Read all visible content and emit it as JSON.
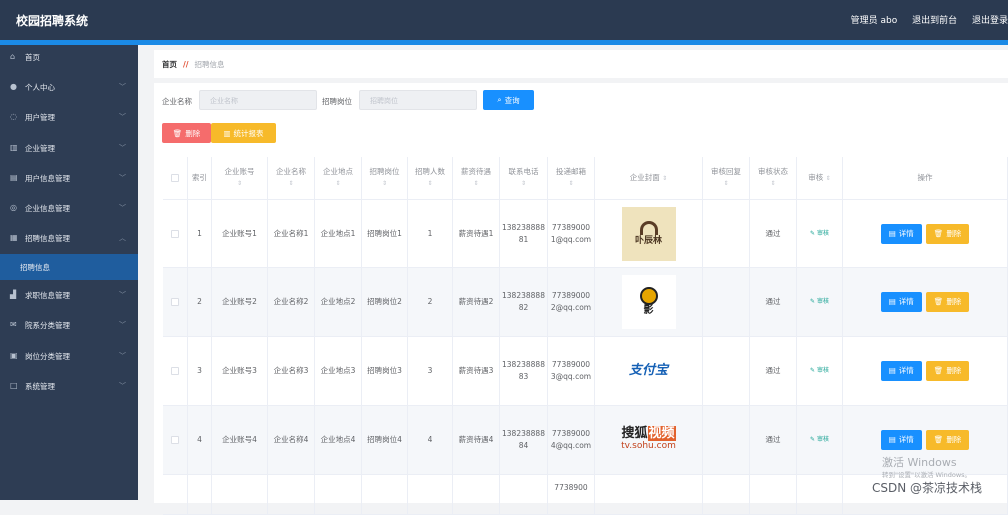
{
  "header": {
    "title": "校园招聘系统",
    "user": "管理员 abo",
    "to_front": "退出到前台",
    "logout": "退出登录"
  },
  "colors": {
    "header": "#2b3a51",
    "accent": "#1b8ae6",
    "sidebar": "#2e3d54",
    "danger": "#f56c6c",
    "warning": "#f7ba2a",
    "primary": "#1890ff"
  },
  "sidebar": {
    "items": [
      {
        "label": "首页",
        "icon": "home-icon",
        "expandable": false
      },
      {
        "label": "个人中心",
        "icon": "user-icon",
        "expandable": true
      },
      {
        "label": "用户管理",
        "icon": "power-icon",
        "expandable": true
      },
      {
        "label": "企业管理",
        "icon": "chart-icon",
        "expandable": true
      },
      {
        "label": "用户信息管理",
        "icon": "id-card-icon",
        "expandable": true
      },
      {
        "label": "企业信息管理",
        "icon": "compass-icon",
        "expandable": true
      },
      {
        "label": "招聘信息管理",
        "icon": "document-icon",
        "expandable": true,
        "expanded": true
      },
      {
        "label": "招聘信息",
        "icon": "",
        "active": true
      },
      {
        "label": "求职信息管理",
        "icon": "bar-icon",
        "expandable": true
      },
      {
        "label": "院系分类管理",
        "icon": "mail-icon",
        "expandable": true
      },
      {
        "label": "岗位分类管理",
        "icon": "clipboard-icon",
        "expandable": true
      },
      {
        "label": "系统管理",
        "icon": "square-icon",
        "expandable": true
      }
    ]
  },
  "breadcrumb": {
    "home": "首页",
    "current": "招聘信息"
  },
  "search": {
    "company_label": "企业名称",
    "company_placeholder": "企业名称",
    "company_value": "",
    "job_label": "招聘岗位",
    "job_placeholder": "招聘岗位",
    "job_value": "",
    "button": "查询"
  },
  "toolbar": {
    "delete": "删除",
    "report": "统计报表"
  },
  "table": {
    "columns": [
      "索引",
      "企业账号",
      "企业名称",
      "企业地点",
      "招聘岗位",
      "招聘人数",
      "薪资待遇",
      "联系电话",
      "投递邮箱",
      "企业封面",
      "审核回复",
      "审核状态",
      "审核",
      "操作"
    ],
    "rows": [
      {
        "index": "1",
        "account": "企业账号1",
        "name": "企业名称1",
        "location": "企业地点1",
        "job": "招聘岗位1",
        "count": "1",
        "salary": "薪资待遇1",
        "phone": "13823888881",
        "email": "773890001@qq.com",
        "cover": "restaurant-logo",
        "reply": "",
        "status": "通过",
        "audit": "审核",
        "detail": "详情",
        "delete": "删除"
      },
      {
        "index": "2",
        "account": "企业账号2",
        "name": "企业名称2",
        "location": "企业地点2",
        "job": "招聘岗位2",
        "count": "2",
        "salary": "薪资待遇2",
        "phone": "13823888882",
        "email": "773890002@qq.com",
        "cover": "film-logo",
        "reply": "",
        "status": "通过",
        "audit": "审核",
        "detail": "详情",
        "delete": "删除"
      },
      {
        "index": "3",
        "account": "企业账号3",
        "name": "企业名称3",
        "location": "企业地点3",
        "job": "招聘岗位3",
        "count": "3",
        "salary": "薪资待遇3",
        "phone": "13823888883",
        "email": "773890003@qq.com",
        "cover": "alipay-logo",
        "reply": "",
        "status": "通过",
        "audit": "审核",
        "detail": "详情",
        "delete": "删除"
      },
      {
        "index": "4",
        "account": "企业账号4",
        "name": "企业名称4",
        "location": "企业地点4",
        "job": "招聘岗位4",
        "count": "4",
        "salary": "薪资待遇4",
        "phone": "13823888884",
        "email": "773890004@qq.com",
        "cover": "sohu-logo",
        "reply": "",
        "status": "通过",
        "audit": "审核",
        "detail": "详情",
        "delete": "删除"
      }
    ],
    "partial_row": {
      "email": "7738900"
    }
  },
  "logos": {
    "alipay": "支付宝",
    "sohu_main": "搜狐",
    "sohu_badge": "视频",
    "sohu_url": "tv.sohu.com",
    "restaurant": "卟辰林",
    "film": "影"
  },
  "watermark": {
    "line1": "激活 Windows",
    "line2": "转到\"设置\"以激活 Windows。",
    "csdn": "CSDN @茶凉技术栈"
  }
}
